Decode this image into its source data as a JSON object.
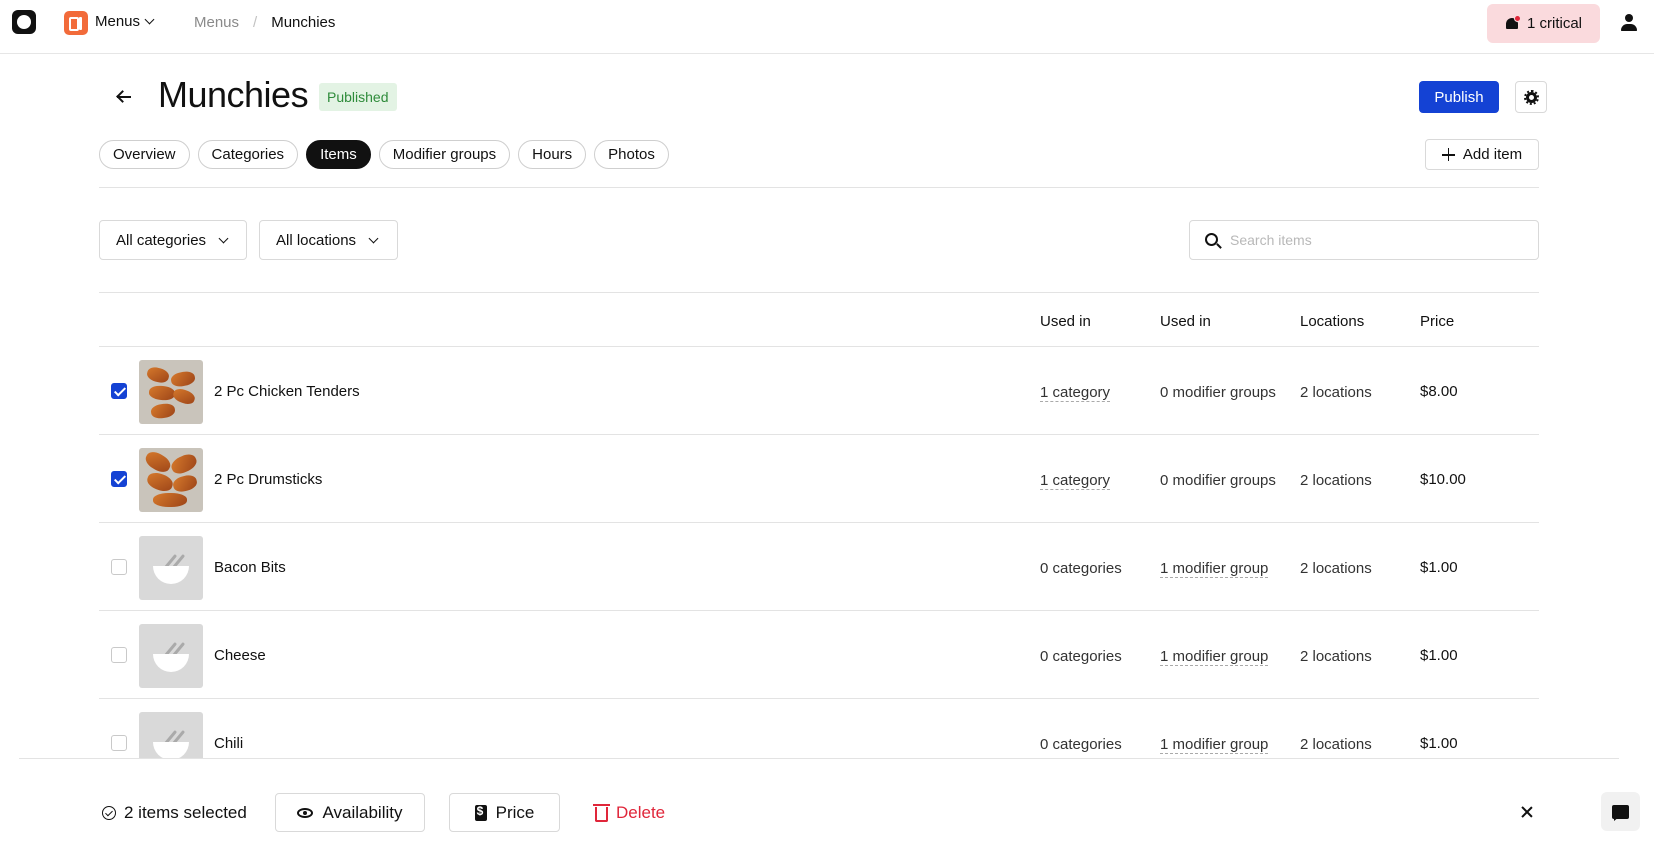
{
  "topbar": {
    "app_name": "Menus",
    "breadcrumb": [
      "Menus",
      "Munchies"
    ],
    "alert_label": "1 critical"
  },
  "header": {
    "title": "Munchies",
    "status": "Published",
    "publish_label": "Publish"
  },
  "tabs": [
    "Overview",
    "Categories",
    "Items",
    "Modifier groups",
    "Hours",
    "Photos"
  ],
  "active_tab": "Items",
  "add_item_label": "Add item",
  "filters": {
    "category": "All categories",
    "location": "All locations"
  },
  "search": {
    "placeholder": "Search items",
    "value": ""
  },
  "table": {
    "columns": [
      "Used in",
      "Used in",
      "Locations",
      "Price"
    ],
    "rows": [
      {
        "name": "2 Pc Chicken Tenders",
        "categories": "1 category",
        "modifiers": "0 modifier groups",
        "locations": "2 locations",
        "price": "$8.00",
        "checked": true,
        "image": "chicken-tenders-photo"
      },
      {
        "name": "2 Pc Drumsticks",
        "categories": "1 category",
        "modifiers": "0 modifier groups",
        "locations": "2 locations",
        "price": "$10.00",
        "checked": true,
        "image": "drumsticks-photo"
      },
      {
        "name": "Bacon Bits",
        "categories": "0 categories",
        "modifiers": "1 modifier group",
        "locations": "2 locations",
        "price": "$1.00",
        "checked": false,
        "image": "placeholder-bowl-icon"
      },
      {
        "name": "Cheese",
        "categories": "0 categories",
        "modifiers": "1 modifier group",
        "locations": "2 locations",
        "price": "$1.00",
        "checked": false,
        "image": "placeholder-bowl-icon"
      },
      {
        "name": "Chili",
        "categories": "0 categories",
        "modifiers": "1 modifier group",
        "locations": "2 locations",
        "price": "$1.00",
        "checked": false,
        "image": "placeholder-bowl-icon"
      }
    ]
  },
  "action_bar": {
    "selected_label": "2 items selected",
    "availability_label": "Availability",
    "price_label": "Price",
    "delete_label": "Delete"
  },
  "colors": {
    "primary": "#1442d4",
    "published_bg": "#e3f3e4",
    "published_text": "#2e8b3a",
    "alert_bg": "#fadadd",
    "danger": "#e0263a"
  }
}
